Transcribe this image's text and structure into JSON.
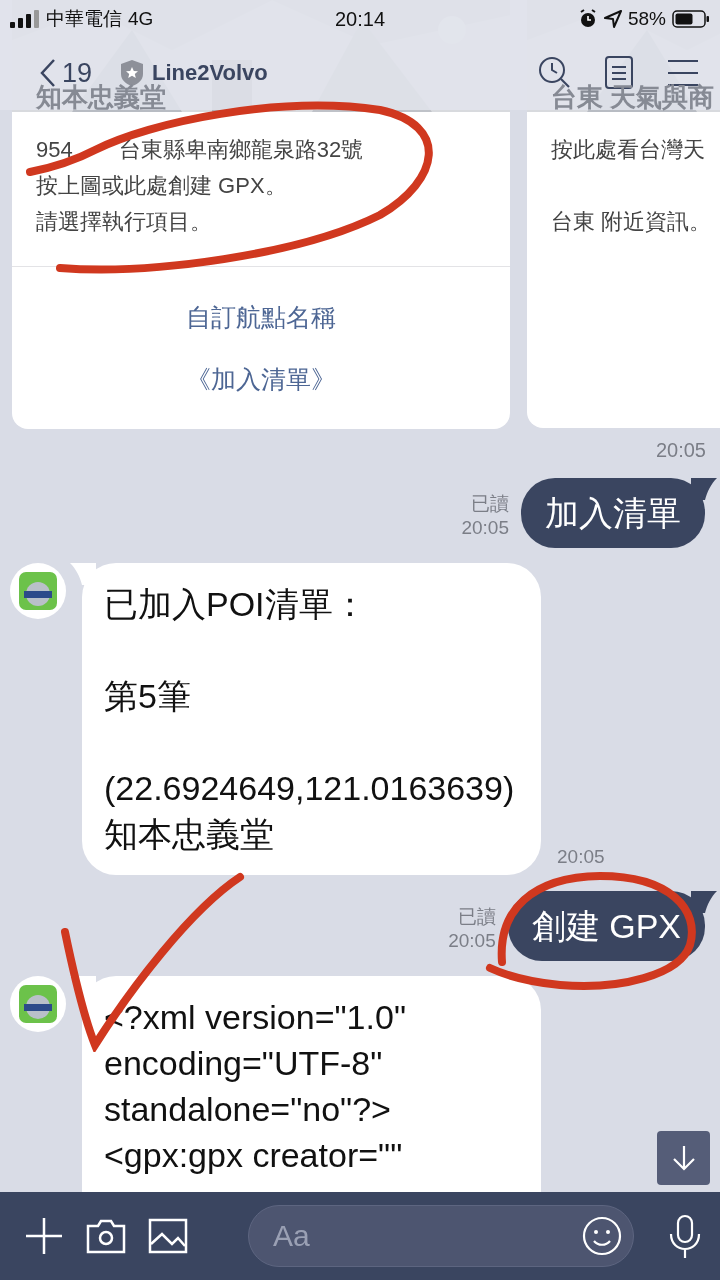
{
  "status_bar": {
    "carrier": "中華電信",
    "network": "4G",
    "time": "20:14",
    "battery": "58%"
  },
  "header": {
    "back_count": "19",
    "title": "Line2Volvo"
  },
  "cards": [
    {
      "title": "知本忠義堂",
      "address_parts": [
        "954",
        "台東縣卑南鄉龍泉路32號"
      ],
      "lines": [
        "按上圖或此處創建 GPX。",
        "請選擇執行項目。"
      ],
      "actions": [
        "自訂航點名稱",
        "《加入清單》"
      ]
    },
    {
      "title": "台東 天氣與商",
      "paragraphs": [
        "按此處看台灣天",
        "台東 附近資訊。"
      ]
    }
  ],
  "messages": [
    {
      "kind": "time",
      "time": "20:05"
    },
    {
      "kind": "sent",
      "read": "已讀",
      "time": "20:05",
      "text": "加入清單"
    },
    {
      "kind": "received",
      "time": "20:05",
      "paragraphs": [
        "已加入POI清單：",
        "第5筆",
        "(22.6924649,121.0163639) 知本忠義堂"
      ]
    },
    {
      "kind": "sent",
      "read": "已讀",
      "time": "20:05",
      "text": "創建 GPX"
    },
    {
      "kind": "received",
      "lines": [
        "<?xml version=\"1.0\"",
        "encoding=\"UTF-8\"",
        "standalone=\"no\"?>",
        "<gpx:gpx creator=\"\""
      ]
    }
  ],
  "input": {
    "placeholder": "Aa"
  },
  "annotations": [
    {
      "kind": "ellipse"
    },
    {
      "kind": "check"
    },
    {
      "kind": "circle"
    }
  ]
}
